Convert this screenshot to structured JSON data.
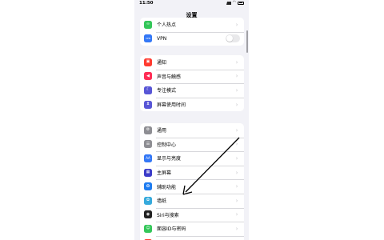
{
  "status_bar": {
    "time": "11:50"
  },
  "header": {
    "title": "设置"
  },
  "groups": [
    {
      "rows": [
        {
          "label": "个人热点",
          "icon": "hotspot-icon",
          "color": "#34c759",
          "glyph": "∞"
        },
        {
          "label": "VPN",
          "icon": "vpn-icon",
          "color": "#3478f6",
          "glyph": "VPN",
          "toggle": "off"
        }
      ]
    },
    {
      "rows": [
        {
          "label": "通知",
          "icon": "notifications-icon",
          "color": "#ff3b30",
          "glyph": "▣"
        },
        {
          "label": "声音与触感",
          "icon": "sound-icon",
          "color": "#ff2d55",
          "glyph": "◀"
        },
        {
          "label": "专注模式",
          "icon": "focus-moon-icon",
          "color": "#5856d6",
          "glyph": "☾"
        },
        {
          "label": "屏幕使用时间",
          "icon": "screen-time-icon",
          "color": "#5856d6",
          "glyph": "⧗"
        }
      ]
    },
    {
      "rows": [
        {
          "label": "通用",
          "icon": "gear-icon",
          "color": "#8e8e93",
          "glyph": "⚙"
        },
        {
          "label": "控制中心",
          "icon": "control-center-icon",
          "color": "#8e8e93",
          "glyph": "☰"
        },
        {
          "label": "显示与亮度",
          "icon": "display-icon",
          "color": "#3478f6",
          "glyph": "AA"
        },
        {
          "label": "主屏幕",
          "icon": "home-screen-icon",
          "color": "#3c3cc8",
          "glyph": "▦"
        },
        {
          "label": "辅助功能",
          "icon": "accessibility-icon",
          "color": "#1e7cf0",
          "glyph": "✪"
        },
        {
          "label": "墙纸",
          "icon": "wallpaper-icon",
          "color": "#36aadc",
          "glyph": "✿"
        },
        {
          "label": "Siri与搜索",
          "icon": "siri-icon",
          "color": "#222222",
          "glyph": "◉"
        },
        {
          "label": "面容ID与密码",
          "icon": "face-id-icon",
          "color": "#34c759",
          "glyph": "☺"
        },
        {
          "label": "SOS紧急联络",
          "icon": "sos-icon",
          "color": "#ff3b30",
          "glyph": "SOS"
        }
      ]
    }
  ],
  "colors": {
    "background": "#f2f2f7",
    "annotation_arrow": "#000000"
  }
}
